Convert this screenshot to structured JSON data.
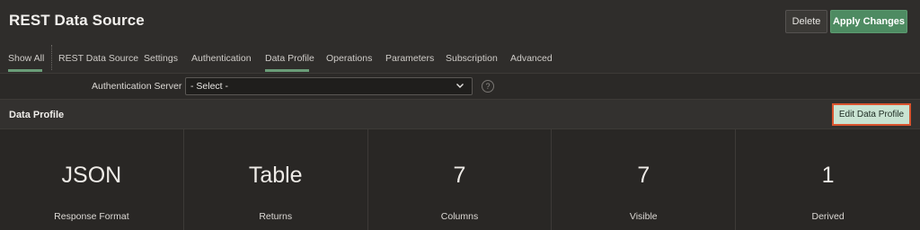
{
  "header": {
    "title": "REST Data Source",
    "delete_label": "Delete",
    "apply_label": "Apply Changes"
  },
  "tabs": [
    {
      "label": "Show All",
      "active": true
    },
    {
      "label": "REST Data Source"
    },
    {
      "label": "Settings"
    },
    {
      "label": "Authentication"
    },
    {
      "label": "Data Profile",
      "active": true
    },
    {
      "label": "Operations"
    },
    {
      "label": "Parameters"
    },
    {
      "label": "Subscription"
    },
    {
      "label": "Advanced"
    }
  ],
  "auth": {
    "label": "Authentication Server",
    "selected_value": "- Select -",
    "help_glyph": "?"
  },
  "region": {
    "title": "Data Profile",
    "edit_button_label": "Edit Data Profile"
  },
  "metrics": [
    {
      "value": "JSON",
      "label": "Response Format"
    },
    {
      "value": "Table",
      "label": "Returns"
    },
    {
      "value": "7",
      "label": "Columns"
    },
    {
      "value": "7",
      "label": "Visible"
    },
    {
      "value": "1",
      "label": "Derived"
    }
  ],
  "colors": {
    "accent_green": "#4e8b62",
    "active_tab_underline": "#6a9c78",
    "highlight_outline": "#d9542f",
    "edit_button_bg": "#c9e3d2"
  },
  "icons": {
    "select_chevron": "chevron-down-icon",
    "help": "help-icon"
  }
}
